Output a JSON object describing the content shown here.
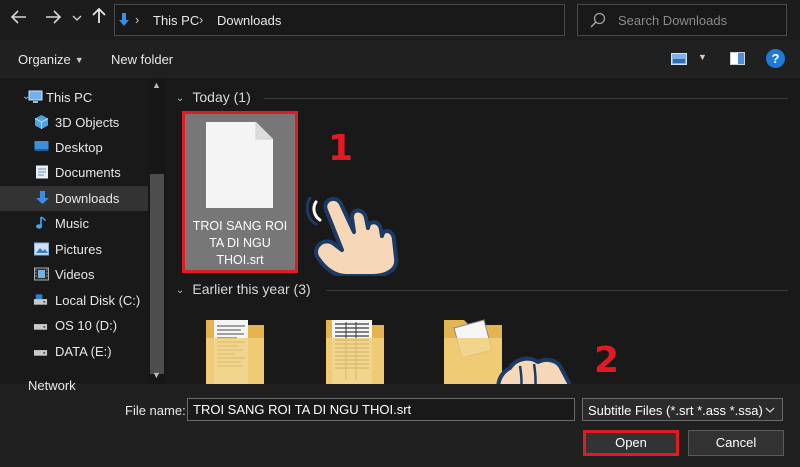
{
  "address_bar": {
    "back_icon": "arrow-left-icon",
    "forward_icon": "arrow-right-icon",
    "recent_icon": "chevron-down-icon",
    "up_icon": "arrow-up-icon",
    "breadcrumbs": [
      "This PC",
      "Downloads"
    ],
    "refresh_icon": "refresh-icon",
    "search_placeholder": "Search Downloads"
  },
  "toolbar": {
    "organize_label": "Organize",
    "new_folder_label": "New folder",
    "help_label": "?"
  },
  "sidebar": {
    "items": [
      {
        "label": "This PC",
        "icon": "computer-icon"
      },
      {
        "label": "3D Objects",
        "icon": "cube-icon"
      },
      {
        "label": "Desktop",
        "icon": "desktop-icon"
      },
      {
        "label": "Documents",
        "icon": "document-icon"
      },
      {
        "label": "Downloads",
        "icon": "download-icon",
        "selected": true
      },
      {
        "label": "Music",
        "icon": "music-icon"
      },
      {
        "label": "Pictures",
        "icon": "pictures-icon"
      },
      {
        "label": "Videos",
        "icon": "video-icon"
      },
      {
        "label": "Local Disk (C:)",
        "icon": "drive-icon"
      },
      {
        "label": "OS 10 (D:)",
        "icon": "drive-icon"
      },
      {
        "label": "DATA (E:)",
        "icon": "drive-icon"
      }
    ],
    "partial_item": "Network"
  },
  "main": {
    "groups": [
      {
        "title": "Today (1)"
      },
      {
        "title": "Earlier this year (3)"
      }
    ],
    "selected_file": {
      "name": "TROI SANG ROI TA DI NGU THOI.srt"
    }
  },
  "annotations": {
    "step1": "1",
    "step2": "2"
  },
  "bottom": {
    "file_name_label": "File name:",
    "file_name_value": "TROI SANG ROI TA DI NGU THOI.srt",
    "file_type_value": "Subtitle Files (*.srt *.ass *.ssa)",
    "open_label": "Open",
    "cancel_label": "Cancel"
  },
  "colors": {
    "highlight_red": "#e01b24",
    "accent_blue": "#1e7ad6"
  }
}
